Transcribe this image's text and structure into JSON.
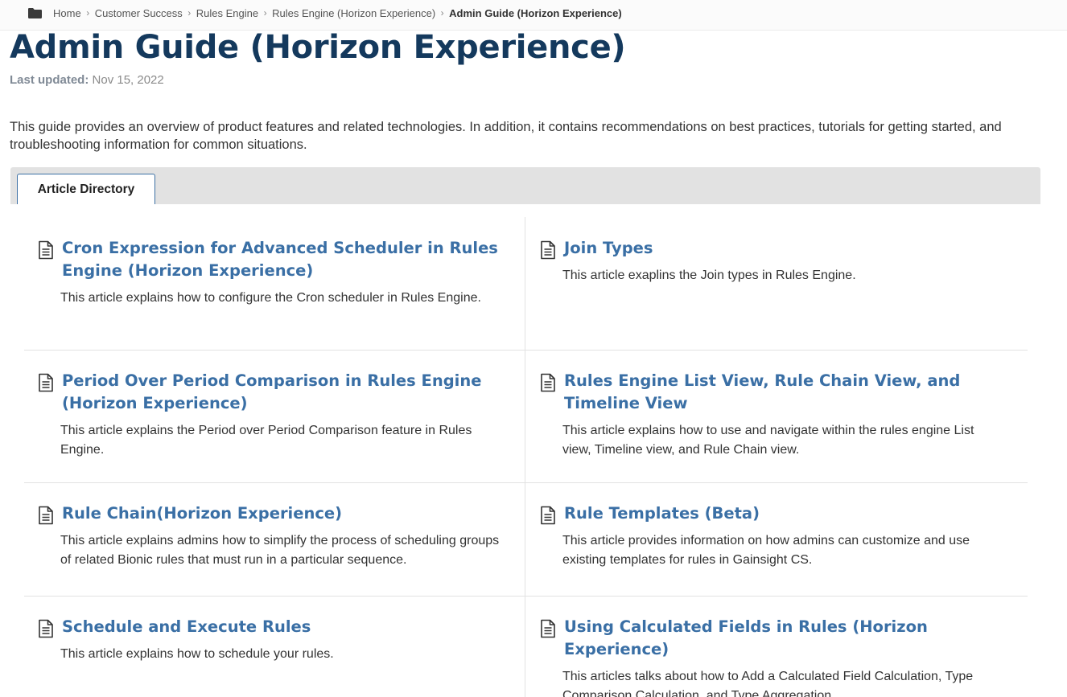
{
  "breadcrumb": {
    "items": [
      {
        "label": "Home"
      },
      {
        "label": "Customer Success"
      },
      {
        "label": "Rules Engine"
      },
      {
        "label": "Rules Engine (Horizon Experience)"
      },
      {
        "label": "Admin Guide (Horizon Experience)"
      }
    ],
    "separator": ">"
  },
  "page": {
    "title": "Admin Guide (Horizon Experience)",
    "updated_label": "Last updated:",
    "updated_value": "Nov 15, 2022",
    "intro": "This guide provides an overview of product features and related technologies. In addition, it contains recommendations on best practices, tutorials for getting started, and troubleshooting information for common situations."
  },
  "tabs": [
    {
      "label": "Article Directory",
      "active": true
    }
  ],
  "articles": [
    {
      "title": "Cron Expression for Advanced Scheduler in Rules Engine (Horizon Experience)",
      "description": "This article explains how to configure the Cron scheduler in Rules Engine."
    },
    {
      "title": "Join Types",
      "description": "This article exaplins the Join types in Rules Engine."
    },
    {
      "title": "Period Over Period Comparison in Rules Engine (Horizon Experience)",
      "description": "This article explains the Period over Period Comparison feature in Rules Engine."
    },
    {
      "title": "Rules Engine List View, Rule Chain View, and Timeline View",
      "description": "This article explains how to use and navigate within the rules engine List view, Timeline view, and Rule Chain view."
    },
    {
      "title": "Rule Chain(Horizon Experience)",
      "description": "This article explains admins how to simplify the process of scheduling groups of related Bionic rules that must run in a particular sequence."
    },
    {
      "title": "Rule Templates (Beta)",
      "description": "This article provides information on how admins can customize and use existing templates for rules in Gainsight CS."
    },
    {
      "title": "Schedule and Execute Rules",
      "description": "This article explains how to schedule your rules."
    },
    {
      "title": "Using Calculated Fields in Rules (Horizon Experience)",
      "description": "This articles talks about how to Add a Calculated Field Calculation, Type Comparison Calculation, and Type Aggregation."
    }
  ],
  "colors": {
    "title": "#14395d",
    "link": "#3a6fa5",
    "tab_border": "#3c6fa4",
    "tab_strip": "#e2e2e2"
  },
  "icons": {
    "breadcrumb": "folder-icon",
    "article": "document-icon",
    "breadcrumb_separator": "chevron-right-icon"
  }
}
